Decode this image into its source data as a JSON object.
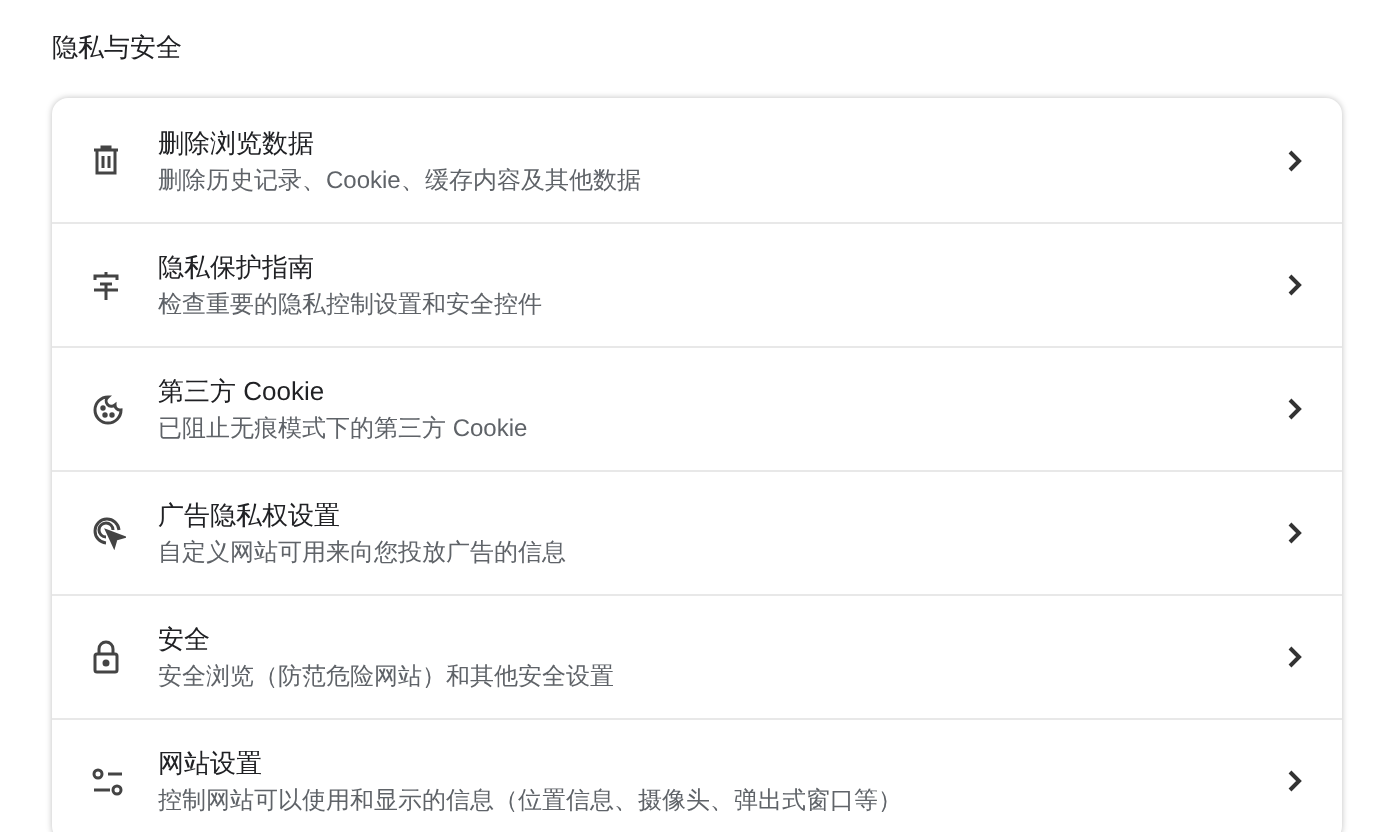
{
  "section_title": "隐私与安全",
  "items": [
    {
      "title": "删除浏览数据",
      "subtitle": "删除历史记录、Cookie、缓存内容及其他数据"
    },
    {
      "title": "隐私保护指南",
      "subtitle": "检查重要的隐私控制设置和安全控件"
    },
    {
      "title": "第三方 Cookie",
      "subtitle": "已阻止无痕模式下的第三方 Cookie"
    },
    {
      "title": "广告隐私权设置",
      "subtitle": "自定义网站可用来向您投放广告的信息"
    },
    {
      "title": "安全",
      "subtitle": "安全浏览（防范危险网站）和其他安全设置"
    },
    {
      "title": "网站设置",
      "subtitle": "控制网站可以使用和显示的信息（位置信息、摄像头、弹出式窗口等）"
    }
  ]
}
